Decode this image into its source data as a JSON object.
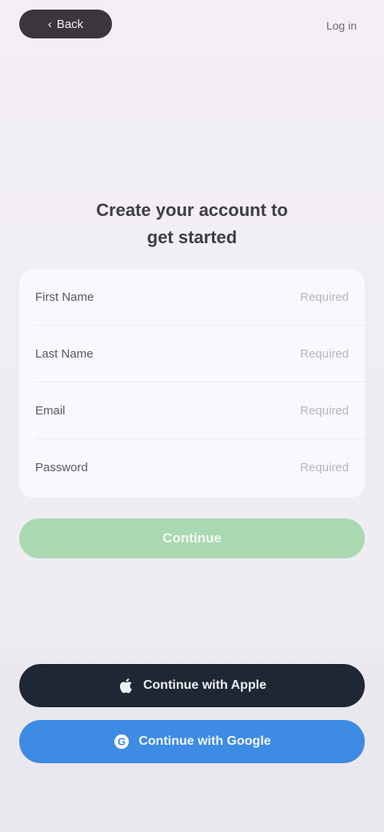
{
  "top_bar": {
    "back_label": "Back",
    "right_label": "Log in"
  },
  "heading": {
    "line1": "Create your account to",
    "line2": "get started"
  },
  "form": {
    "rows": [
      {
        "label": "First Name",
        "placeholder": "Required"
      },
      {
        "label": "Last Name",
        "placeholder": "Required"
      },
      {
        "label": "Email",
        "placeholder": "Required"
      },
      {
        "label": "Password",
        "placeholder": "Required"
      }
    ],
    "submit_label": "Continue"
  },
  "social": {
    "apple_label": "Continue with Apple",
    "google_label": "Continue with Google"
  },
  "colors": {
    "submit_bg": "#a9d8b1",
    "dark_button_bg": "#1f2735",
    "blue_button_bg": "#3e8be4",
    "back_pill_bg": "#3a363b"
  }
}
